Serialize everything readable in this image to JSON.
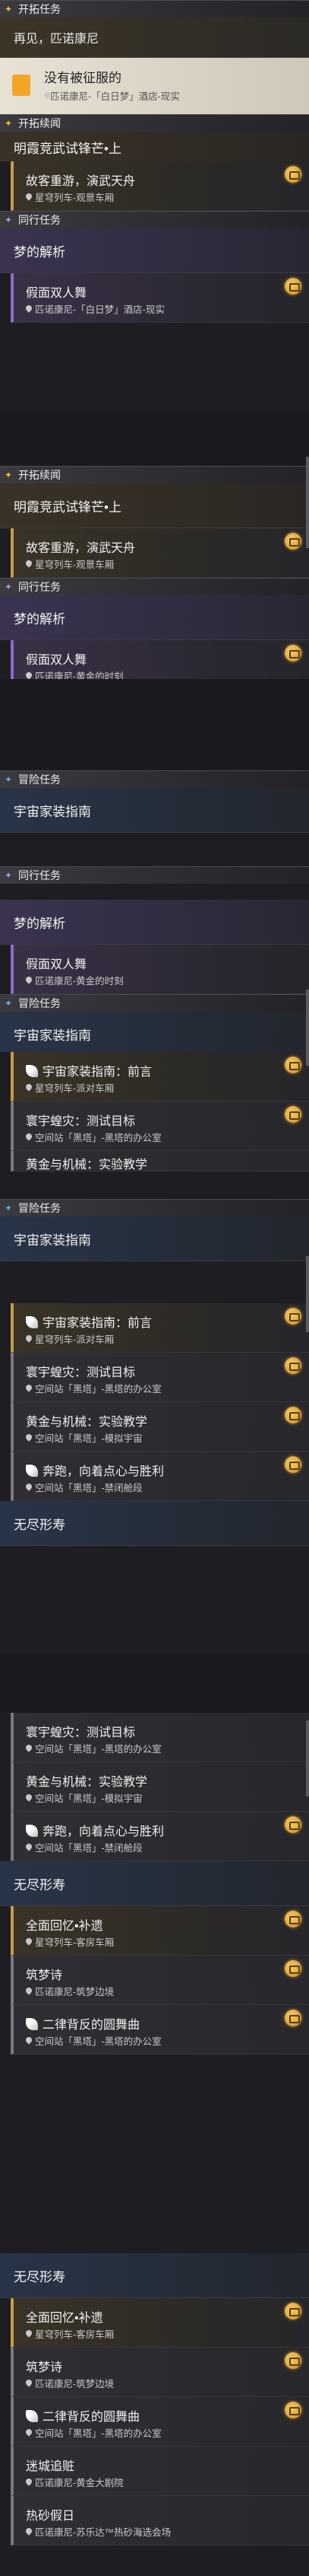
{
  "labels": {
    "trailblaze": "开拓任务",
    "trailblaze_cont": "开拓续闻",
    "companion": "同行任务",
    "adventure": "冒险任务"
  },
  "s1": {
    "title1": "再见，匹诺康尼",
    "featured_name": "没有被征服的",
    "featured_loc": "匹诺康尼-「白日梦」酒店-现实"
  },
  "quests": {
    "mingxia": "明霞竞武试锋芒•上",
    "guke": "故客重游，演武天舟",
    "guke_loc": "星穹列车-观景车厢",
    "dream": "梦的解析",
    "fake": "假面双人舞",
    "fake_loc": "匹诺康尼-黄金的时刻",
    "fake_loc2": "匹诺康尼-「白日梦」酒店-现实",
    "home": "宇宙家装指南",
    "home_intro": "宇宙家装指南：前言",
    "home_intro_loc": "星穹列车-派对车厢",
    "locust": "寰宇蝗灾：测试目标",
    "locust_loc": "空间站「黑塔」-黑塔的办公室",
    "gold": "黄金与机械：实验教学",
    "gold_loc": "空间站「黑塔」-模拟宇宙",
    "gold_short": "黄金与机械：实验教学",
    "run": "奔跑，向着点心与胜利",
    "run_loc": "空间站「黑塔」-禁闭舱段",
    "wuming": "无尽形寿",
    "quanmian": "全面回忆•补遗",
    "quanmian_loc": "星穹列车-客房车厢",
    "zhumeng": "筑梦诗",
    "zhumeng_loc": "匹诺康尼-筑梦边境",
    "erlv": "二律背反的圆舞曲",
    "erlv_loc": "空间站「黑塔」-黑塔的办公室",
    "micheng": "迷城追赃",
    "micheng_loc": "匹诺康尼-黄金大剧院",
    "reshui": "热砂假日",
    "reshui_loc": "匹诺康尼-苏乐达™热砂海选会场"
  }
}
